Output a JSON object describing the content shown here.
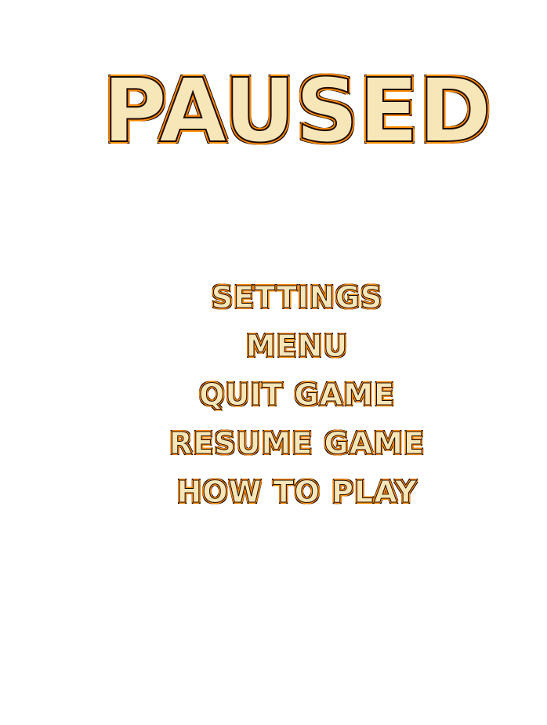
{
  "paused_screen": {
    "title": "PAUSED",
    "menu_items": [
      {
        "label": "SETTINGS"
      },
      {
        "label": "MENU"
      },
      {
        "label": "QUIT GAME"
      },
      {
        "label": "RESUME GAME"
      },
      {
        "label": "HOW TO PLAY"
      }
    ]
  },
  "colors": {
    "background": "#ffffff",
    "text_fill": "#f7e6b8",
    "outline_inner": "#ff8a00",
    "outline_outer": "#1e0b04"
  }
}
